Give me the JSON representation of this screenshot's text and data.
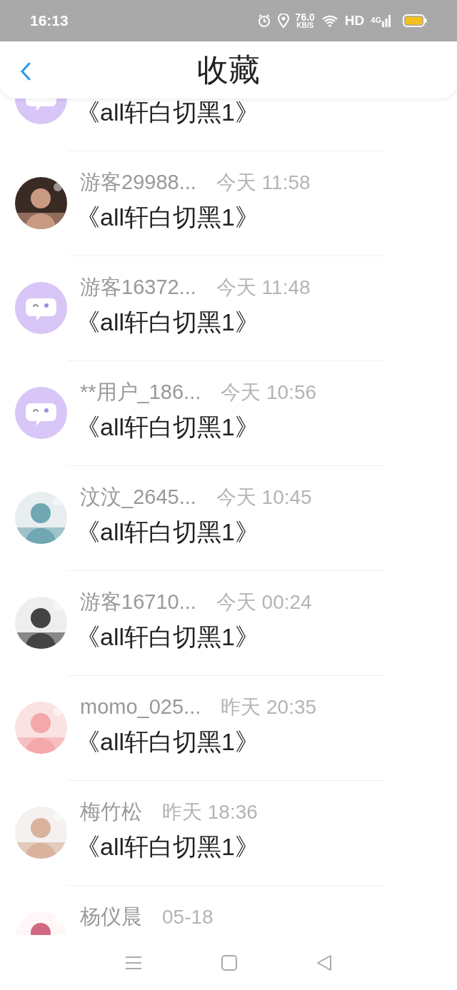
{
  "status_bar": {
    "time": "16:13",
    "speed": "76.0",
    "speed_unit": "KB/S",
    "hd": "HD",
    "network": "4G"
  },
  "header": {
    "title": "收藏"
  },
  "rows": [
    {
      "kind": "chat",
      "title": "《all轩白切黑1》"
    },
    {
      "kind": "picture",
      "name": "游客29988...",
      "time": "今天 11:58",
      "title": "《all轩白切黑1》"
    },
    {
      "kind": "chat",
      "name": "游客16372...",
      "time": "今天 11:48",
      "title": "《all轩白切黑1》"
    },
    {
      "kind": "chat",
      "name": "**用户_186...",
      "time": "今天 10:56",
      "title": "《all轩白切黑1》"
    },
    {
      "kind": "picture",
      "name": "汶汶_2645...",
      "time": "今天 10:45",
      "title": "《all轩白切黑1》"
    },
    {
      "kind": "picture",
      "name": "游客16710...",
      "time": "今天 00:24",
      "title": "《all轩白切黑1》"
    },
    {
      "kind": "picture",
      "name": "momo_025...",
      "time": "昨天 20:35",
      "title": "《all轩白切黑1》"
    },
    {
      "kind": "picture",
      "name": "梅竹松",
      "time": "昨天 18:36",
      "title": "《all轩白切黑1》"
    },
    {
      "kind": "picture",
      "name": "杨仪晨",
      "time": "05-18"
    }
  ]
}
